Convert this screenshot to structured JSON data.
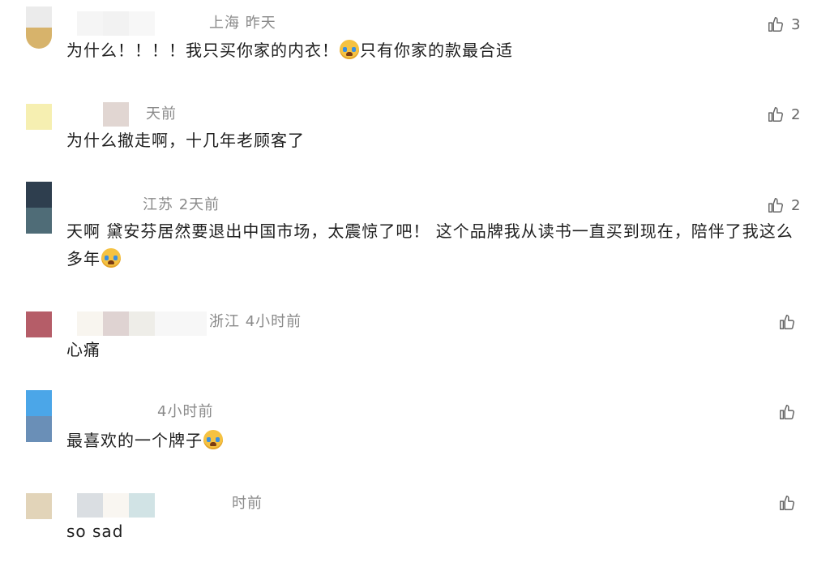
{
  "comments": [
    {
      "avatar_colors": [
        "#ebebeb",
        "#d7b36b"
      ],
      "meta_colors": [
        "#f3f3f3",
        "#f0f0f0",
        "#f6f6f6"
      ],
      "meta_text": "上海 昨天",
      "text_parts": [
        "为什么！！！！我只买你家的内衣！",
        "只有你家的款最合适"
      ],
      "emoji": "crying-face-emoji",
      "likes": "3"
    },
    {
      "avatar_colors": [
        "#f6efb1",
        "#f6efb1"
      ],
      "meta_colors": [
        "#ffffff",
        "#dccfca",
        "#ffffff"
      ],
      "meta_text": "天前",
      "text_parts": [
        "为什么撤走啊，十几年老顾客了"
      ],
      "likes": "2"
    },
    {
      "avatar_colors": [
        "#2e3e4e",
        "#4f6c77"
      ],
      "meta_colors": [
        "#ffffff",
        "#ffffff",
        "#ffffff"
      ],
      "meta_text": "江苏 2天前",
      "text_parts": [
        "天啊 黛安芬居然要退出中国市场，太震惊了吧！ 这个品牌我从读书一直买到现在，陪伴了我这么多年"
      ],
      "emoji": "crying-face-emoji",
      "likes": "2"
    },
    {
      "avatar_colors": [
        "#b55d68",
        "#b55d68"
      ],
      "meta_colors": [
        "#f7f3ec",
        "#d9cbca",
        "#ebeae4",
        "#f6f6f6"
      ],
      "meta_text": "浙江 4小时前",
      "text_parts": [
        "心痛"
      ],
      "likes": ""
    },
    {
      "avatar_colors": [
        "#4ba6e8",
        "#6a8fb7"
      ],
      "meta_colors": [
        "#ffffff",
        "#ffffff",
        "#ffffff"
      ],
      "meta_text": "4小时前",
      "text_parts": [
        "最喜欢的一个牌子"
      ],
      "emoji": "crying-face-emoji",
      "likes": ""
    },
    {
      "avatar_colors": [
        "#e2d4b9",
        "#e2d4b9"
      ],
      "meta_colors": [
        "#d3d8dd",
        "#f8f4ef",
        "#c9dee0"
      ],
      "meta_text": "时前",
      "text_parts": [
        "so sad"
      ],
      "likes": ""
    }
  ]
}
